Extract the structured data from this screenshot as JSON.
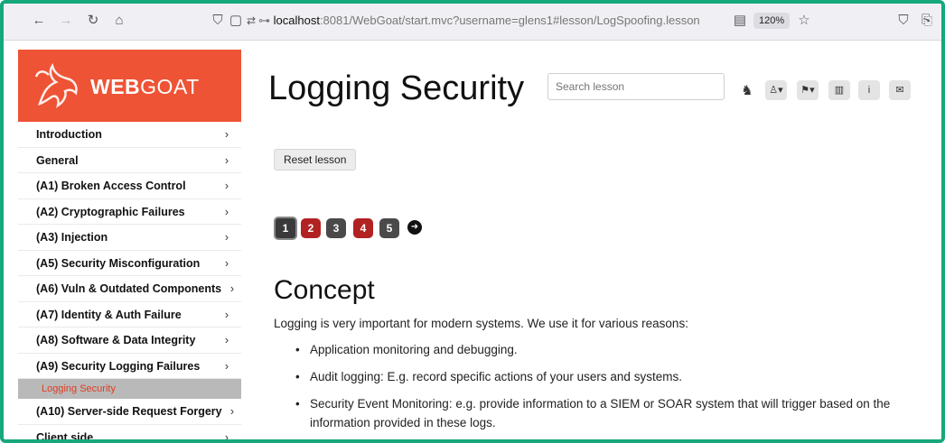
{
  "browser": {
    "url_host": "localhost",
    "url_rest": ":8081/WebGoat/start.mvc?username=glens1#lesson/LogSpoofing.lesson",
    "zoom": "120%",
    "icons": [
      "back-icon",
      "forward-icon",
      "reload-icon",
      "home-icon",
      "shield-icon",
      "page-icon",
      "permissions-icon",
      "key-icon",
      "reader-icon",
      "star-icon",
      "pocket-icon",
      "extensions-icon"
    ]
  },
  "sidebar": {
    "logo_bold": "WEB",
    "logo_light": "GOAT",
    "items": [
      {
        "label": "Introduction"
      },
      {
        "label": "General"
      },
      {
        "label": "(A1) Broken Access Control"
      },
      {
        "label": "(A2) Cryptographic Failures"
      },
      {
        "label": "(A3) Injection"
      },
      {
        "label": "(A5) Security Misconfiguration"
      },
      {
        "label": "(A6) Vuln & Outdated Components"
      },
      {
        "label": "(A7) Identity & Auth Failure"
      },
      {
        "label": "(A8) Software & Data Integrity"
      },
      {
        "label": "(A9) Security Logging Failures"
      }
    ],
    "sub_item": "Logging Security",
    "items_after": [
      {
        "label": "(A10) Server-side Request Forgery"
      },
      {
        "label": "Client side"
      }
    ],
    "chevron": "›"
  },
  "header": {
    "title": "Logging Security",
    "search_placeholder": "Search lesson"
  },
  "lesson": {
    "reset_label": "Reset lesson",
    "pages": [
      "1",
      "2",
      "3",
      "4",
      "5"
    ],
    "page_colors": [
      "#3a3a3a",
      "#b22222",
      "#4a4a4a",
      "#b22222",
      "#4a4a4a"
    ],
    "heading": "Concept",
    "intro": "Logging is very important for modern systems. We use it for various reasons:",
    "bullets": [
      "Application monitoring and debugging.",
      "Audit logging: E.g. record specific actions of your users and systems.",
      "Security Event Monitoring: e.g. provide information to a SIEM or SOAR system that will trigger based on the information provided in these logs."
    ]
  },
  "colors": {
    "accent": "#ee5335",
    "frame": "#16a87a",
    "sub_item_text": "#e03d1f"
  }
}
